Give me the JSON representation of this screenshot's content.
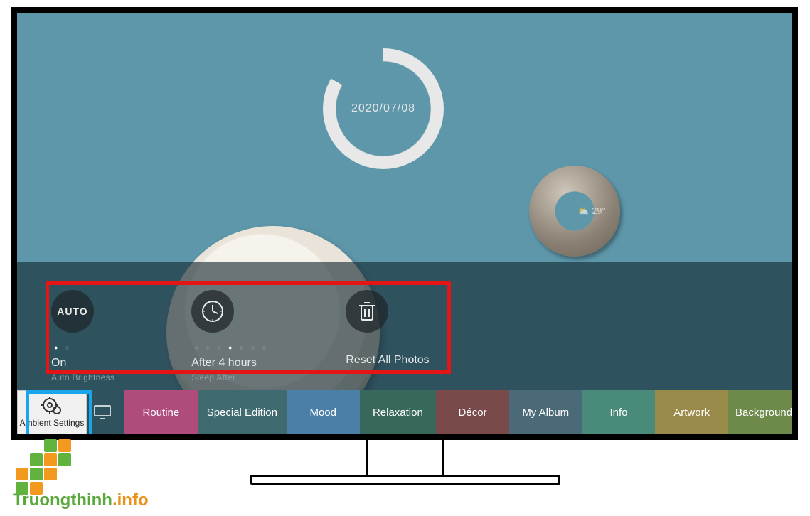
{
  "clock": {
    "date_text": "2020/07/08"
  },
  "weather": {
    "temp_text": "⛅ 29°"
  },
  "settings_row": {
    "auto_brightness": {
      "icon_text": "AUTO",
      "value": "On",
      "label": "Auto Brightness"
    },
    "sleep_after": {
      "value": "After 4 hours",
      "label": "Sleep After"
    },
    "reset_photos": {
      "value": "Reset All Photos"
    }
  },
  "tiles": {
    "ambient_settings": "Ambient Settings",
    "routine": "Routine",
    "special_edition": "Special Edition",
    "mood": "Mood",
    "relaxation": "Relaxation",
    "decor": "Décor",
    "my_album": "My Album",
    "info": "Info",
    "artwork": "Artwork",
    "background": "Background"
  },
  "watermark": {
    "text_part1": "Truongthinh",
    "text_part2": ".info"
  }
}
